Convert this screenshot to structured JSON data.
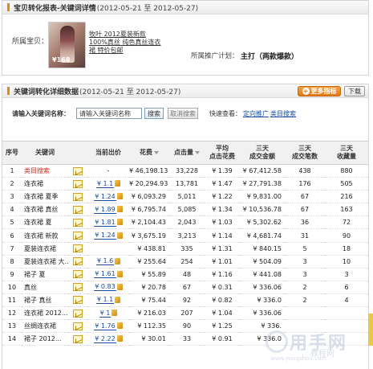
{
  "detail_panel": {
    "title": "宝贝转化报表-关键词详情",
    "date_range": "(2012-05-21 至 2012-05-27)",
    "product_label": "所属宝贝：",
    "product_name": "牧叶 2012夏装新款 100%真丝 纯色真丝连衣裙 特价包邮",
    "thumb_price": "¥168",
    "plan_label": "所属推广计划：",
    "plan_value": "主打（两款爆款）"
  },
  "report_panel": {
    "title": "关键词转化详细数据",
    "date_range": "(2012-05-21 至 2012-05-27)",
    "more_button": "更多指标",
    "download_button": "下载",
    "search_label": "请输入关键词名称：",
    "search_input_value": "请输入关键词名称",
    "search_button": "搜索",
    "cancel_button": "取消搜索",
    "quick_label": "快速查看：",
    "quick_links": [
      "定向推广",
      "类目搜索"
    ]
  },
  "table": {
    "headers": [
      "序号",
      "关键词",
      "",
      "当前出价",
      "花费",
      "点击量",
      "平均\n点击花费",
      "三天\n成交金额",
      "三天\n成交笔数",
      "三天\n收藏量"
    ],
    "rows": [
      {
        "no": "1",
        "kw": "类目搜索",
        "bid": "-",
        "cost": "¥ 46,198.13",
        "clicks": "33,228",
        "cpc": "¥ 1.39",
        "amount": "¥ 67,412.58",
        "orders": "438",
        "favs": "880",
        "red": true
      },
      {
        "no": "2",
        "kw": "连衣裙",
        "bid": "¥ 1.1",
        "cost": "¥ 20,294.93",
        "clicks": "13,781",
        "cpc": "¥ 1.47",
        "amount": "¥ 27,791.38",
        "orders": "176",
        "favs": "505",
        "red": false
      },
      {
        "no": "3",
        "kw": "连衣裙 夏季",
        "bid": "¥ 1.24",
        "cost": "¥ 6,093.29",
        "clicks": "5,011",
        "cpc": "¥ 1.22",
        "amount": "¥ 9,831.00",
        "orders": "67",
        "favs": "216",
        "red": false
      },
      {
        "no": "4",
        "kw": "连衣裙 真丝",
        "bid": "¥ 1.89",
        "cost": "¥ 6,795.74",
        "clicks": "5,085",
        "cpc": "¥ 1.34",
        "amount": "¥ 10,536.78",
        "orders": "67",
        "favs": "163",
        "red": false
      },
      {
        "no": "5",
        "kw": "连衣裙 夏",
        "bid": "¥ 1.81",
        "cost": "¥ 2,104.43",
        "clicks": "2,043",
        "cpc": "¥ 1.03",
        "amount": "¥ 5,302.62",
        "orders": "36",
        "favs": "72",
        "red": false
      },
      {
        "no": "6",
        "kw": "连衣裙 新款",
        "bid": "¥ 1.24",
        "cost": "¥ 3,675.19",
        "clicks": "3,213",
        "cpc": "¥ 1.14",
        "amount": "¥ 4,681.74",
        "orders": "31",
        "favs": "90",
        "red": false
      },
      {
        "no": "7",
        "kw": "夏装连衣裙",
        "bid": "",
        "cost": "¥ 438.81",
        "clicks": "335",
        "cpc": "¥ 1.31",
        "amount": "¥ 840.15",
        "orders": "5",
        "favs": "18",
        "red": false
      },
      {
        "no": "8",
        "kw": "夏装连衣裙 大...",
        "bid": "¥ 1.6",
        "cost": "¥ 255.64",
        "clicks": "254",
        "cpc": "¥ 1.01",
        "amount": "¥ 504.09",
        "orders": "3",
        "favs": "10",
        "red": false
      },
      {
        "no": "9",
        "kw": "裙子 夏",
        "bid": "¥ 1.61",
        "cost": "¥ 55.89",
        "clicks": "48",
        "cpc": "¥ 1.16",
        "amount": "¥ 441.08",
        "orders": "3",
        "favs": "3",
        "red": false
      },
      {
        "no": "10",
        "kw": "真丝",
        "bid": "¥ 0.83",
        "cost": "¥ 20.78",
        "clicks": "67",
        "cpc": "¥ 0.31",
        "amount": "¥ 336.06",
        "orders": "2",
        "favs": "6",
        "red": false
      },
      {
        "no": "11",
        "kw": "裙子 真丝",
        "bid": "¥ 1.1",
        "cost": "¥ 75.44",
        "clicks": "92",
        "cpc": "¥ 0.82",
        "amount": "¥ 336.0",
        "orders": "2",
        "favs": "4",
        "red": false
      },
      {
        "no": "12",
        "kw": "连衣裙 2012...",
        "bid": "¥ 1",
        "cost": "¥ 216.03",
        "clicks": "207",
        "cpc": "¥ 1.04",
        "amount": "¥ 336.06",
        "orders": "",
        "favs": "",
        "red": false
      },
      {
        "no": "13",
        "kw": "丝绸连衣裙",
        "bid": "¥ 1.76",
        "cost": "¥ 112.35",
        "clicks": "90",
        "cpc": "¥ 1.25",
        "amount": "¥ 336.",
        "orders": "",
        "favs": "",
        "red": false
      },
      {
        "no": "14",
        "kw": "裙子 2012...",
        "bid": "¥ 2.22",
        "cost": "¥ 30.01",
        "clicks": "33",
        "cpc": "¥ 0.91",
        "amount": "¥ 336.0",
        "orders": "",
        "favs": "",
        "red": false
      }
    ]
  },
  "watermark": {
    "line1": "用手网",
    "line2": "教程网",
    "line3": "www.yongshou.com"
  }
}
